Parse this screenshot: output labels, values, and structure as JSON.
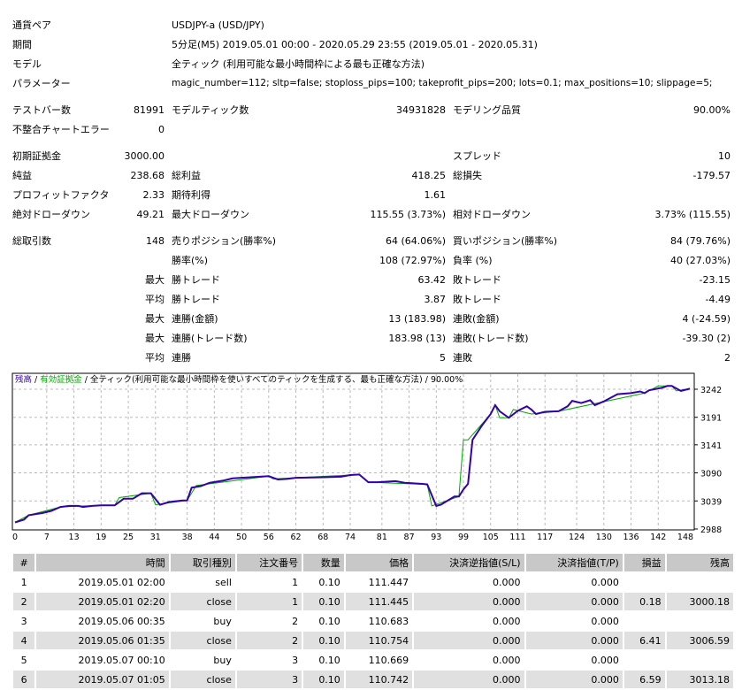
{
  "summary": {
    "symbol_label": "通貨ペア",
    "symbol": "USDJPY-a (USD/JPY)",
    "period_label": "期間",
    "period": "5分足(M5) 2019.05.01 00:00 - 2020.05.29 23:55 (2019.05.01 - 2020.05.31)",
    "model_label": "モデル",
    "model": "全ティック (利用可能な最小時間枠による最も正確な方法)",
    "params_label": "パラメーター",
    "params": "magic_number=112; sltp=false; stoploss_pips=100; takeprofit_pips=200; lots=0.1; max_positions=10; slippage=5;",
    "bars_label": "テストバー数",
    "bars": "81991",
    "ticks_label": "モデルティック数",
    "ticks": "34931828",
    "quality_label": "モデリング品質",
    "quality": "90.00%",
    "mismatch_label": "不整合チャートエラー",
    "mismatch": "0",
    "deposit_label": "初期証拠金",
    "deposit": "3000.00",
    "spread_label": "スプレッド",
    "spread": "10",
    "net_label": "純益",
    "net": "238.68",
    "gross_profit_label": "総利益",
    "gross_profit": "418.25",
    "gross_loss_label": "総損失",
    "gross_loss": "-179.57",
    "pf_label": "プロフィットファクタ",
    "pf": "2.33",
    "expected_label": "期待利得",
    "expected": "1.61",
    "abs_dd_label": "絶対ドローダウン",
    "abs_dd": "49.21",
    "max_dd_label": "最大ドローダウン",
    "max_dd": "115.55 (3.73%)",
    "rel_dd_label": "相対ドローダウン",
    "rel_dd": "3.73% (115.55)",
    "total_label": "総取引数",
    "total": "148",
    "short_label": "売りポジション(勝率%)",
    "short": "64 (64.06%)",
    "long_label": "買いポジション(勝率%)",
    "long": "84 (79.76%)",
    "win_label": "勝率(%)",
    "win": "108 (72.97%)",
    "loss_label": "負率 (%)",
    "loss": "40 (27.03%)",
    "max": "最大",
    "avg": "平均",
    "largest_win_label": "勝トレード",
    "largest_win": "63.42",
    "largest_loss_label": "敗トレード",
    "largest_loss": "-23.15",
    "avg_win_label": "勝トレード",
    "avg_win": "3.87",
    "avg_loss_label": "敗トレード",
    "avg_loss": "-4.49",
    "cons_wins_label": "連勝(金額)",
    "cons_wins": "13 (183.98)",
    "cons_losses_label": "連敗(金額)",
    "cons_losses": "4 (-24.59)",
    "cons_profit_label": "連勝(トレード数)",
    "cons_profit": "183.98 (13)",
    "cons_loss_label": "連敗(トレード数)",
    "cons_loss": "-39.30 (2)",
    "avg_cons_wins_label": "連勝",
    "avg_cons_wins": "5",
    "avg_cons_losses_label": "連敗",
    "avg_cons_losses": "2"
  },
  "chart_data": {
    "type": "line",
    "legend": {
      "balance": "残高",
      "equity": "有効証拠金",
      "model": "全ティック(利用可能な最小時間枠を使いすべてのティックを生成する、最も正確な方法)",
      "quality": "90.00%",
      "sep": " / "
    },
    "colors": {
      "balance": "#3300aa",
      "equity": "#00aa00"
    },
    "x_ticks": [
      0,
      7,
      13,
      19,
      25,
      31,
      38,
      44,
      50,
      56,
      62,
      68,
      74,
      81,
      87,
      93,
      99,
      105,
      111,
      117,
      124,
      130,
      136,
      142,
      148
    ],
    "y_ticks": [
      2988,
      3039,
      3090,
      3141,
      3191,
      3242
    ],
    "xlim": [
      0,
      150
    ],
    "ylim": [
      2988,
      3260
    ],
    "balance": [
      [
        0,
        3000
      ],
      [
        2,
        3005
      ],
      [
        3,
        3013
      ],
      [
        6,
        3017
      ],
      [
        8,
        3021
      ],
      [
        10,
        3028
      ],
      [
        12,
        3030
      ],
      [
        14,
        3030
      ],
      [
        15,
        3028
      ],
      [
        17,
        3030
      ],
      [
        19,
        3031
      ],
      [
        22,
        3031
      ],
      [
        24,
        3043
      ],
      [
        26,
        3043
      ],
      [
        28,
        3053
      ],
      [
        30,
        3053
      ],
      [
        32,
        3032
      ],
      [
        34,
        3037
      ],
      [
        37,
        3040
      ],
      [
        38,
        3040
      ],
      [
        39,
        3063
      ],
      [
        41,
        3066
      ],
      [
        43,
        3072
      ],
      [
        46,
        3076
      ],
      [
        48,
        3080
      ],
      [
        52,
        3082
      ],
      [
        56,
        3084
      ],
      [
        58,
        3078
      ],
      [
        60,
        3079
      ],
      [
        62,
        3081
      ],
      [
        68,
        3082
      ],
      [
        72,
        3083
      ],
      [
        74,
        3086
      ],
      [
        76,
        3087
      ],
      [
        78,
        3073
      ],
      [
        80,
        3073
      ],
      [
        84,
        3075
      ],
      [
        86,
        3072
      ],
      [
        90,
        3070
      ],
      [
        91,
        3069
      ],
      [
        93,
        3030
      ],
      [
        94,
        3032
      ],
      [
        97,
        3047
      ],
      [
        98,
        3047
      ],
      [
        99,
        3060
      ],
      [
        100,
        3070
      ],
      [
        101,
        3150
      ],
      [
        103,
        3175
      ],
      [
        105,
        3197
      ],
      [
        106,
        3213
      ],
      [
        107,
        3202
      ],
      [
        109,
        3190
      ],
      [
        111,
        3203
      ],
      [
        113,
        3211
      ],
      [
        114,
        3205
      ],
      [
        115,
        3197
      ],
      [
        117,
        3201
      ],
      [
        120,
        3202
      ],
      [
        122,
        3211
      ],
      [
        123,
        3221
      ],
      [
        125,
        3217
      ],
      [
        127,
        3222
      ],
      [
        128,
        3213
      ],
      [
        130,
        3220
      ],
      [
        133,
        3233
      ],
      [
        136,
        3235
      ],
      [
        138,
        3238
      ],
      [
        139,
        3235
      ],
      [
        140,
        3240
      ],
      [
        143,
        3245
      ],
      [
        144,
        3248
      ],
      [
        145,
        3248
      ],
      [
        147,
        3239
      ],
      [
        149,
        3243
      ]
    ],
    "equity": [
      [
        0,
        3000
      ],
      [
        3,
        3013
      ],
      [
        10,
        3028
      ],
      [
        15,
        3030
      ],
      [
        22,
        3031
      ],
      [
        23,
        3045
      ],
      [
        30,
        3053
      ],
      [
        31,
        3032
      ],
      [
        38,
        3040
      ],
      [
        40,
        3067
      ],
      [
        56,
        3084
      ],
      [
        57,
        3079
      ],
      [
        76,
        3087
      ],
      [
        78,
        3073
      ],
      [
        91,
        3069
      ],
      [
        92,
        3030
      ],
      [
        98,
        3047
      ],
      [
        99,
        3150
      ],
      [
        100,
        3150
      ],
      [
        105,
        3197
      ],
      [
        106,
        3213
      ],
      [
        107,
        3190
      ],
      [
        109,
        3190
      ],
      [
        110,
        3205
      ],
      [
        114,
        3197
      ],
      [
        120,
        3202
      ],
      [
        139,
        3235
      ],
      [
        142,
        3248
      ],
      [
        145,
        3248
      ],
      [
        146,
        3239
      ],
      [
        149,
        3243
      ]
    ]
  },
  "trades": {
    "headers": [
      "#",
      "時間",
      "取引種別",
      "注文番号",
      "数量",
      "価格",
      "決済逆指値(S/L)",
      "決済指値(T/P)",
      "損益",
      "残高"
    ],
    "rows": [
      [
        "1",
        "2019.05.01 02:00",
        "sell",
        "1",
        "0.10",
        "111.447",
        "0.000",
        "0.000",
        "",
        ""
      ],
      [
        "2",
        "2019.05.01 02:20",
        "close",
        "1",
        "0.10",
        "111.445",
        "0.000",
        "0.000",
        "0.18",
        "3000.18"
      ],
      [
        "3",
        "2019.05.06 00:35",
        "buy",
        "2",
        "0.10",
        "110.683",
        "0.000",
        "0.000",
        "",
        ""
      ],
      [
        "4",
        "2019.05.06 01:35",
        "close",
        "2",
        "0.10",
        "110.754",
        "0.000",
        "0.000",
        "6.41",
        "3006.59"
      ],
      [
        "5",
        "2019.05.07 00:10",
        "buy",
        "3",
        "0.10",
        "110.669",
        "0.000",
        "0.000",
        "",
        ""
      ],
      [
        "6",
        "2019.05.07 01:05",
        "close",
        "3",
        "0.10",
        "110.742",
        "0.000",
        "0.000",
        "6.59",
        "3013.18"
      ]
    ]
  }
}
